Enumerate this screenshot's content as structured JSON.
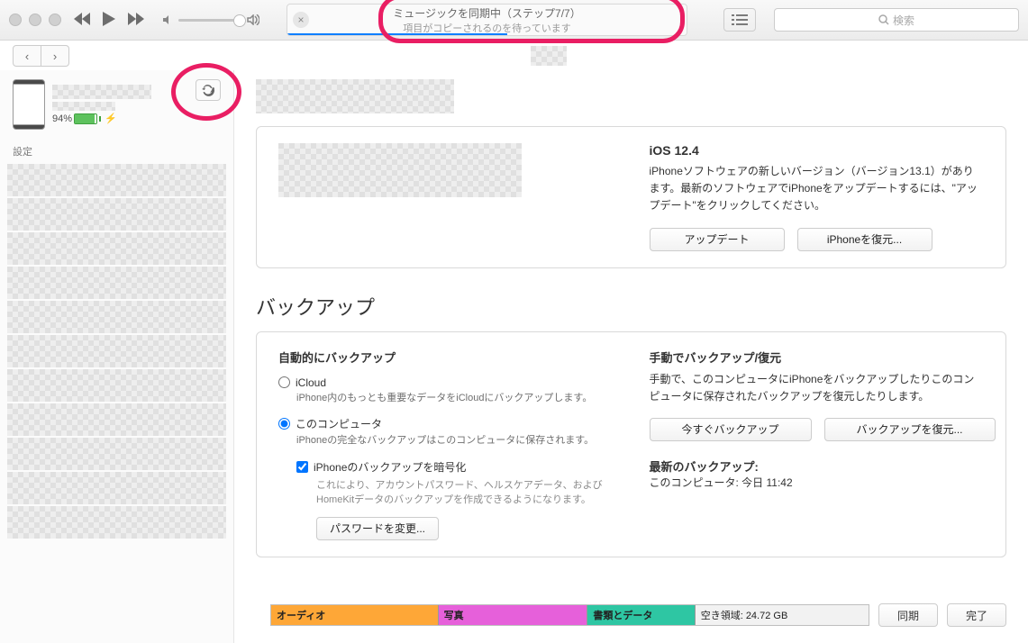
{
  "toolbar": {
    "lcd_title": "ミュージックを同期中（ステップ7/7）",
    "lcd_sub": "項目がコピーされるのを待っています",
    "search_placeholder": "検索"
  },
  "sidebar": {
    "battery_pct": "94%",
    "settings_header": "設定"
  },
  "summary": {
    "ios_title": "iOS 12.4",
    "ios_desc": "iPhoneソフトウェアの新しいバージョン（バージョン13.1）があります。最新のソフトウェアでiPhoneをアップデートするには、\"アップデート\"をクリックしてください。",
    "update_btn": "アップデート",
    "restore_btn": "iPhoneを復元..."
  },
  "backup": {
    "heading": "バックアップ",
    "auto_title": "自動的にバックアップ",
    "icloud_label": "iCloud",
    "icloud_desc": "iPhone内のもっとも重要なデータをiCloudにバックアップします。",
    "computer_label": "このコンピュータ",
    "computer_desc": "iPhoneの完全なバックアップはこのコンピュータに保存されます。",
    "encrypt_label": "iPhoneのバックアップを暗号化",
    "encrypt_desc": "これにより、アカウントパスワード、ヘルスケアデータ、およびHomeKitデータのバックアップを作成できるようになります。",
    "password_btn": "パスワードを変更...",
    "manual_title": "手動でバックアップ/復元",
    "manual_desc": "手動で、このコンピュータにiPhoneをバックアップしたりこのコンピュータに保存されたバックアップを復元したりします。",
    "backup_now_btn": "今すぐバックアップ",
    "restore_backup_btn": "バックアップを復元...",
    "latest_title": "最新のバックアップ:",
    "latest_value": "このコンピュータ: 今日 11:42"
  },
  "storage": {
    "audio": "オーディオ",
    "photos": "写真",
    "docs": "書類とデータ",
    "free": "空き領域: 24.72 GB"
  },
  "bottom": {
    "sync": "同期",
    "done": "完了"
  }
}
